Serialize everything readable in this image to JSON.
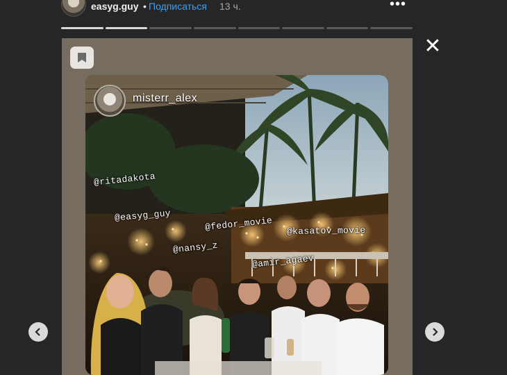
{
  "header": {
    "username": "easyg.guy",
    "separator": "•",
    "follow_label": "Подписаться",
    "time": "13 ч.",
    "more_label": "•••",
    "progress": {
      "segments": 8,
      "completed": 2
    }
  },
  "close_label": "✕",
  "story": {
    "author": "misterr_alex",
    "tags": [
      "@ritadakota",
      "@easyg_guy",
      "@fedor_movie",
      "@kasatov_movie",
      "@nansy_z",
      "@amir_agaev"
    ]
  },
  "icons": {
    "bookmark": "bookmark-icon",
    "prev": "chevron-left-icon",
    "next": "chevron-right-icon",
    "more": "more-horizontal-icon",
    "close": "close-icon"
  },
  "colors": {
    "background": "#262626",
    "story_background": "#766c5f",
    "follow_link": "#3f9ef5"
  }
}
